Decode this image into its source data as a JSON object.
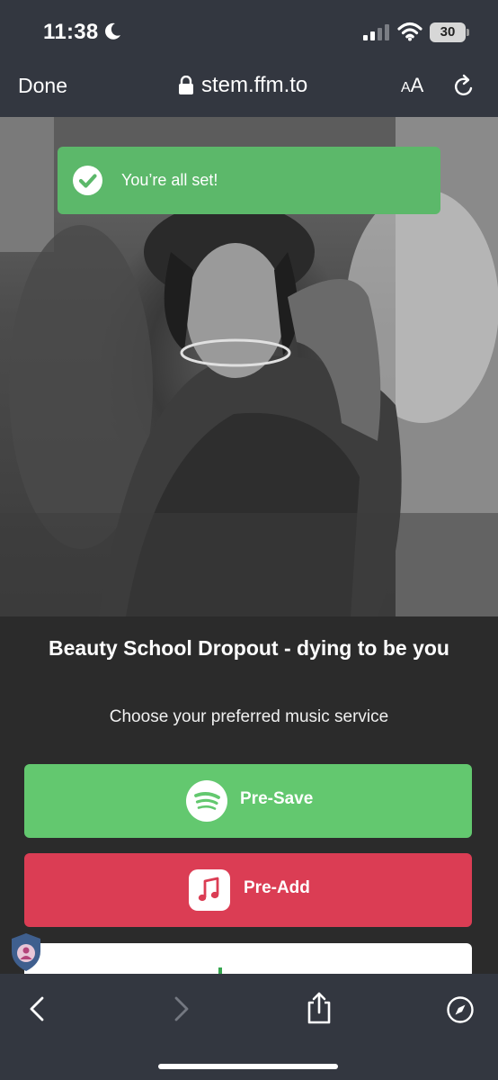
{
  "status_bar": {
    "time": "11:38",
    "battery": "30",
    "icons": [
      "moon-icon",
      "cellular-signal-icon",
      "wifi-icon",
      "battery-icon"
    ]
  },
  "browser": {
    "done_label": "Done",
    "url": "stem.ffm.to",
    "text_size_label_small": "A",
    "text_size_label_large": "A",
    "icons": [
      "lock-icon",
      "reload-icon"
    ]
  },
  "toast": {
    "message": "You’re all set!",
    "color": "#5cb86a",
    "icon": "check-circle-icon"
  },
  "release": {
    "title": "Beauty School Dropout - dying to be you",
    "prompt": "Choose your preferred music service"
  },
  "services": [
    {
      "label": "Pre-Save",
      "icon": "spotify-icon",
      "color": "#63c86f"
    },
    {
      "label": "Pre-Add",
      "icon": "apple-music-icon",
      "color": "#db3d54"
    }
  ],
  "toolbar": {
    "icons": [
      "back-icon",
      "forward-icon",
      "share-icon",
      "compass-icon"
    ],
    "background": "#333740"
  }
}
